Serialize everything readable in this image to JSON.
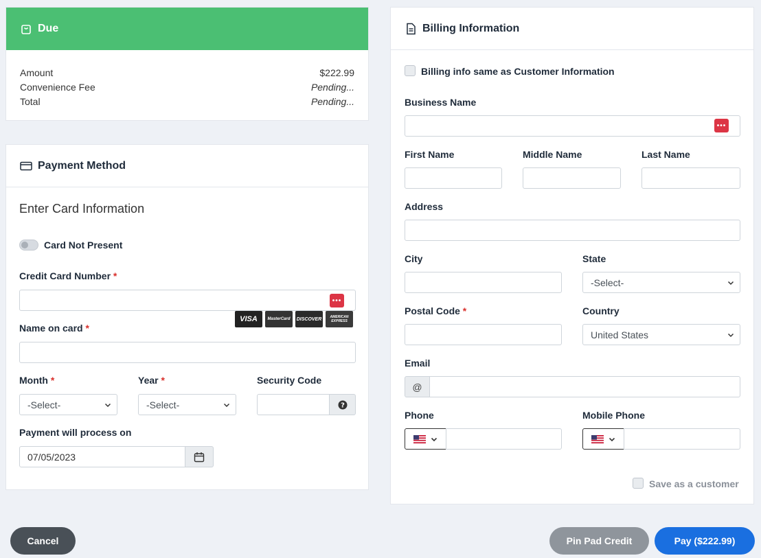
{
  "due": {
    "title": "Due",
    "rows": [
      {
        "label": "Amount",
        "value": "$222.99"
      },
      {
        "label": "Convenience Fee",
        "value": "Pending..."
      },
      {
        "label": "Total",
        "value": "Pending..."
      }
    ]
  },
  "payment": {
    "title": "Payment Method",
    "subtitle": "Enter Card Information",
    "card_not_present": "Card Not Present",
    "cc_label": "Credit Card Number",
    "name_label": "Name on card",
    "month_label": "Month",
    "year_label": "Year",
    "security_label": "Security Code",
    "month_value": "-Select-",
    "year_value": "-Select-",
    "process_label": "Payment will process on",
    "process_date": "07/05/2023",
    "required_mark": "*",
    "card_logos": [
      "VISA",
      "MasterCard",
      "DISCOVER",
      "AMERICAN EXPRESS"
    ]
  },
  "billing": {
    "title": "Billing Information",
    "same_as": "Billing info same as Customer Information",
    "business_label": "Business Name",
    "first_label": "First Name",
    "middle_label": "Middle Name",
    "last_label": "Last Name",
    "address_label": "Address",
    "city_label": "City",
    "state_label": "State",
    "state_value": "-Select-",
    "postal_label": "Postal Code",
    "country_label": "Country",
    "country_value": "United States",
    "email_label": "Email",
    "email_prefix": "@",
    "phone_label": "Phone",
    "mobile_label": "Mobile Phone",
    "save_customer": "Save as a customer",
    "required_mark": "*"
  },
  "actions": {
    "cancel": "Cancel",
    "pinpad": "Pin Pad Credit",
    "pay": "Pay ($222.99)"
  },
  "colors": {
    "due_header": "#4bbf73",
    "pay_button": "#1a6fe0",
    "pinpad_button": "#8f959c",
    "cancel_button": "#495057",
    "required": "#d9302c"
  },
  "icons": {
    "due": "shopping-bag-icon",
    "payment": "credit-card-icon",
    "billing": "document-icon",
    "calendar": "calendar-icon",
    "question": "question-circle-icon",
    "password": "password-manager-icon",
    "flag": "us-flag-icon"
  }
}
